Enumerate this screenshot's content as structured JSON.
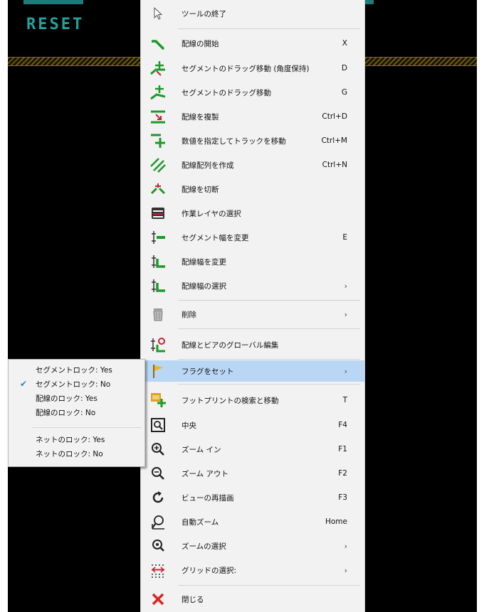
{
  "canvas": {
    "label": "RESET"
  },
  "menu": {
    "items": [
      {
        "label": "ツールの終了",
        "shortcut": "",
        "icon": "cursor-arrow-icon"
      },
      {
        "label": "配線の開始",
        "shortcut": "X",
        "icon": "route-track-icon"
      },
      {
        "label": "セグメントのドラッグ移動 (角度保持)",
        "shortcut": "D",
        "icon": "drag-45-icon"
      },
      {
        "label": "セグメントのドラッグ移動",
        "shortcut": "G",
        "icon": "drag-free-icon"
      },
      {
        "label": "配線を複製",
        "shortcut": "Ctrl+D",
        "icon": "duplicate-icon"
      },
      {
        "label": "数値を指定してトラックを移動",
        "shortcut": "Ctrl+M",
        "icon": "move-exact-icon"
      },
      {
        "label": "配線配列を作成",
        "shortcut": "Ctrl+N",
        "icon": "array-icon"
      },
      {
        "label": "配線を切断",
        "shortcut": "",
        "icon": "break-track-icon"
      },
      {
        "label": "作業レイヤの選択",
        "shortcut": "",
        "icon": "layer-icon"
      },
      {
        "label": "セグメント幅を変更",
        "shortcut": "E",
        "icon": "segment-width-icon"
      },
      {
        "label": "配線幅を変更",
        "shortcut": "",
        "icon": "track-width-icon"
      },
      {
        "label": "配線幅の選択",
        "shortcut": "",
        "icon": "track-width-select-icon",
        "submenu": true
      },
      {
        "label": "削除",
        "shortcut": "",
        "icon": "trash-icon",
        "submenu": true
      },
      {
        "label": "配線とビアのグローバル編集",
        "shortcut": "",
        "icon": "global-edit-icon"
      },
      {
        "label": "フラグをセット",
        "shortcut": "",
        "icon": "flag-icon",
        "submenu": true,
        "highlighted": true
      },
      {
        "label": "フットプリントの検索と移動",
        "shortcut": "T",
        "icon": "footprint-move-icon"
      },
      {
        "label": "中央",
        "shortcut": "F4",
        "icon": "zoom-center-icon"
      },
      {
        "label": "ズーム イン",
        "shortcut": "F1",
        "icon": "zoom-in-icon"
      },
      {
        "label": "ズーム アウト",
        "shortcut": "F2",
        "icon": "zoom-out-icon"
      },
      {
        "label": "ビューの再描画",
        "shortcut": "F3",
        "icon": "redraw-icon"
      },
      {
        "label": "自動ズーム",
        "shortcut": "Home",
        "icon": "zoom-fit-icon"
      },
      {
        "label": "ズームの選択",
        "shortcut": "",
        "icon": "zoom-select-icon",
        "submenu": true
      },
      {
        "label": "グリッドの選択:",
        "shortcut": "",
        "icon": "grid-icon",
        "submenu": true
      },
      {
        "label": "閉じる",
        "shortcut": "",
        "icon": "close-icon"
      }
    ]
  },
  "submenu": {
    "items": [
      {
        "label": "セグメントロック: Yes",
        "checked": false
      },
      {
        "label": "セグメントロック: No",
        "checked": true
      },
      {
        "label": "配線のロック: Yes",
        "checked": false
      },
      {
        "label": "配線のロック: No",
        "checked": false
      },
      {
        "label": "ネットのロック: Yes",
        "checked": false
      },
      {
        "label": "ネットのロック: No",
        "checked": false
      }
    ]
  },
  "colors": {
    "highlight": "#b9d7f5",
    "check": "#2c7fd0",
    "menu_bg": "#f2f2f2",
    "reset_text": "#1fa3a0"
  }
}
